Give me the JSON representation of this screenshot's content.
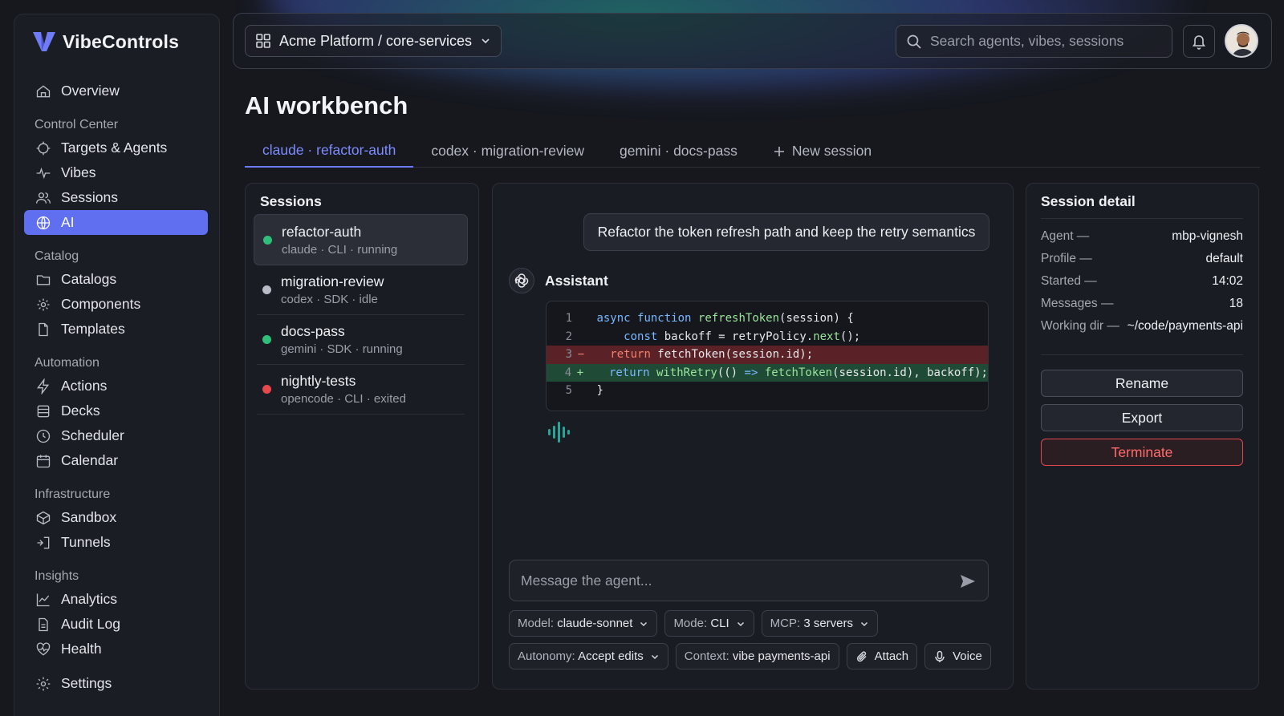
{
  "app": {
    "name": "VibeControls"
  },
  "sidebar": {
    "overview": "Overview",
    "sections": [
      {
        "title": "Control Center",
        "items": [
          {
            "label": "Targets & Agents",
            "icon": "crosshair-icon"
          },
          {
            "label": "Vibes",
            "icon": "activity-icon"
          },
          {
            "label": "Sessions",
            "icon": "users-icon"
          },
          {
            "label": "AI",
            "icon": "globe-ai-icon",
            "active": true
          }
        ]
      },
      {
        "title": "Catalog",
        "items": [
          {
            "label": "Catalogs",
            "icon": "folder-icon"
          },
          {
            "label": "Components",
            "icon": "component-icon"
          },
          {
            "label": "Templates",
            "icon": "file-icon"
          }
        ]
      },
      {
        "title": "Automation",
        "items": [
          {
            "label": "Actions",
            "icon": "bolt-icon"
          },
          {
            "label": "Decks",
            "icon": "deck-icon"
          },
          {
            "label": "Scheduler",
            "icon": "clock-icon"
          },
          {
            "label": "Calendar",
            "icon": "calendar-icon"
          }
        ]
      },
      {
        "title": "Infrastructure",
        "items": [
          {
            "label": "Sandbox",
            "icon": "box-icon"
          },
          {
            "label": "Tunnels",
            "icon": "tunnel-icon"
          }
        ]
      },
      {
        "title": "Insights",
        "items": [
          {
            "label": "Analytics",
            "icon": "chart-line-icon"
          },
          {
            "label": "Audit Log",
            "icon": "file-text-icon"
          },
          {
            "label": "Health",
            "icon": "heart-pulse-icon"
          }
        ]
      }
    ],
    "settings": "Settings"
  },
  "topbar": {
    "workspace": "Acme Platform / core-services",
    "search_placeholder": "Search agents, vibes, sessions"
  },
  "page": {
    "title": "AI workbench"
  },
  "tabs": [
    "claude · refactor-auth",
    "codex · migration-review",
    "gemini · docs-pass"
  ],
  "new_session_label": "New session",
  "sessions": {
    "title": "Sessions",
    "items": [
      {
        "name": "refactor-auth",
        "meta": "claude · CLI · running",
        "status_color": "#2fbf7a",
        "selected": true
      },
      {
        "name": "migration-review",
        "meta": "codex · SDK · idle",
        "status_color": "#b9bcc6"
      },
      {
        "name": "docs-pass",
        "meta": "gemini · SDK · running",
        "status_color": "#2fbf7a"
      },
      {
        "name": "nightly-tests",
        "meta": "opencode · CLI · exited",
        "status_color": "#e5484d"
      }
    ]
  },
  "chat": {
    "user_message": "Refactor the token refresh path and keep the retry semantics",
    "assistant_label": "Assistant",
    "code_lines": [
      {
        "n": "1",
        "marker": "",
        "type": "ctx"
      },
      {
        "n": "2",
        "marker": "",
        "type": "ctx"
      },
      {
        "n": "3",
        "marker": "−",
        "type": "del"
      },
      {
        "n": "4",
        "marker": "+",
        "type": "add"
      },
      {
        "n": "5",
        "marker": "",
        "type": "ctx"
      }
    ],
    "code_tokens": {
      "l1_kw": "async function",
      "l1_fn": "refreshToken",
      "l1_rest": "(session) {",
      "l2_kw": "const",
      "l2_a": " backoff = retryPolicy.",
      "l2_fn": "next",
      "l2_b": "();",
      "l3_kw": "return",
      "l3_rest": " fetchToken(session.id);",
      "l4_kw": "return",
      "l4_fn": "withRetry",
      "l4_a": "(() ",
      "l4_arrow": "=>",
      "l4_fn2": "fetchToken",
      "l4_b": "(session.id), backoff);",
      "l5": "}"
    },
    "input_placeholder": "Message the agent...",
    "chips_row1": [
      {
        "key": "Model:",
        "value": "claude-sonnet"
      },
      {
        "key": "Mode:",
        "value": "CLI"
      },
      {
        "key": "MCP:",
        "value": "3 servers"
      }
    ],
    "chips_row2": [
      {
        "key": "Autonomy:",
        "value": "Accept edits"
      },
      {
        "key": "Context:",
        "value": "vibe payments-api"
      }
    ],
    "attach_label": "Attach",
    "voice_label": "Voice"
  },
  "detail": {
    "title": "Session detail",
    "rows": [
      {
        "key": "Agent —",
        "value": "mbp-vignesh"
      },
      {
        "key": "Profile —",
        "value": "default"
      },
      {
        "key": "Started —",
        "value": "14:02"
      },
      {
        "key": "Messages —",
        "value": "18"
      },
      {
        "key": "Working dir —",
        "value": "~/code/payments-api"
      }
    ],
    "rename": "Rename",
    "export": "Export",
    "terminate": "Terminate"
  }
}
